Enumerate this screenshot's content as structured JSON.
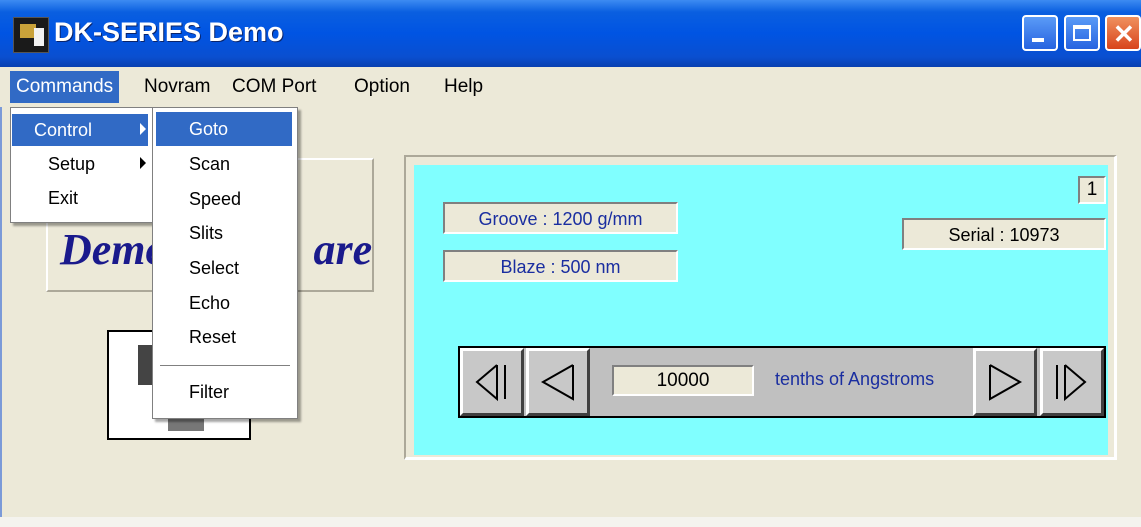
{
  "window": {
    "title": "DK-SERIES Demo"
  },
  "menubar": {
    "items": [
      {
        "label": "Commands"
      },
      {
        "label": "Novram"
      },
      {
        "label": "COM Port"
      },
      {
        "label": "Option"
      },
      {
        "label": "Help"
      }
    ]
  },
  "commands_menu": {
    "items": [
      {
        "label": "Control"
      },
      {
        "label": "Setup"
      },
      {
        "label": "Exit"
      }
    ]
  },
  "control_submenu": {
    "items": [
      {
        "label": "Goto"
      },
      {
        "label": "Scan"
      },
      {
        "label": "Speed"
      },
      {
        "label": "Slits"
      },
      {
        "label": "Select"
      },
      {
        "label": "Echo"
      },
      {
        "label": "Reset"
      },
      {
        "label": "Filter"
      }
    ]
  },
  "background_panel": {
    "logo_text_left": "Demo",
    "logo_text_right": "are"
  },
  "status": {
    "groove": "Groove : 1200 g/mm",
    "blaze": "Blaze : 500 nm",
    "serial": "Serial : 10973",
    "counter": "1"
  },
  "wavelength": {
    "value": "10000",
    "unit": "tenths of Angstroms"
  },
  "colors": {
    "panel_bg": "#80ffff",
    "label_text": "#1a2ea0",
    "menu_highlight": "#316ac5"
  }
}
